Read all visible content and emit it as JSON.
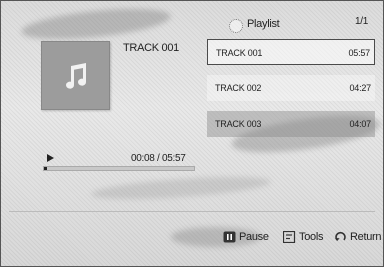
{
  "header": {
    "title": "Playlist",
    "page": "1/1",
    "icon": "playlist-icon"
  },
  "now_playing": {
    "title": "TRACK 001",
    "icon": "music-note-icon",
    "time": "00:08 / 05:57",
    "progress_fraction": 0.022
  },
  "tracks": [
    {
      "name": "TRACK 001",
      "duration": "05:57",
      "selected": true
    },
    {
      "name": "TRACK 002",
      "duration": "04:27",
      "selected": false
    },
    {
      "name": "TRACK 003",
      "duration": "04:07",
      "selected": false
    }
  ],
  "footer": {
    "pause_label": "Pause",
    "tools_label": "Tools",
    "return_label": "Return"
  }
}
